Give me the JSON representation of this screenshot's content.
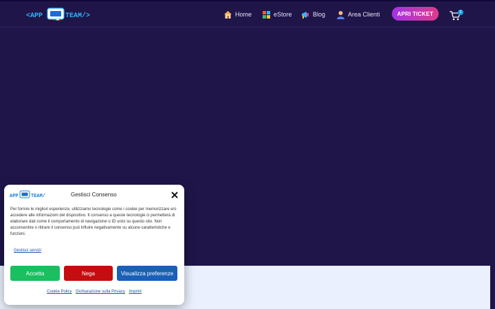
{
  "header": {
    "nav": [
      {
        "label": "Home",
        "icon": "house-icon"
      },
      {
        "label": "eStore",
        "icon": "store-icon"
      },
      {
        "label": "Blog",
        "icon": "megaphone-icon"
      },
      {
        "label": "Area Clienti",
        "icon": "user-icon"
      }
    ],
    "ticket_button": "APRI TICKET",
    "cart_count": "0"
  },
  "consent": {
    "title": "Gestisci Consenso",
    "body": "Per fornire le migliori esperienze, utilizziamo tecnologie come i cookie per memorizzare e/o accedere alle informazioni del dispositivo. Il consenso a queste tecnologie ci permetterà di elaborare dati come il comportamento di navigazione o ID unici su questo sito. Non acconsentire o ritirare il consenso può influire negativamente su alcune caratteristiche e funzioni.",
    "manage_services": "Gestisci servizi",
    "accept": "Accetta",
    "deny": "Nega",
    "preferences": "Visualizza preferenze",
    "links": [
      "Cookie Policy",
      "Dichiarazione sulla Privacy",
      "Imprint"
    ]
  },
  "colors": {
    "background": "#1f1549",
    "accept": "#1abf5f",
    "deny": "#c40d10",
    "preferences": "#1a5fb8",
    "accent_start": "#a234e6",
    "accent_end": "#e23a8a"
  }
}
